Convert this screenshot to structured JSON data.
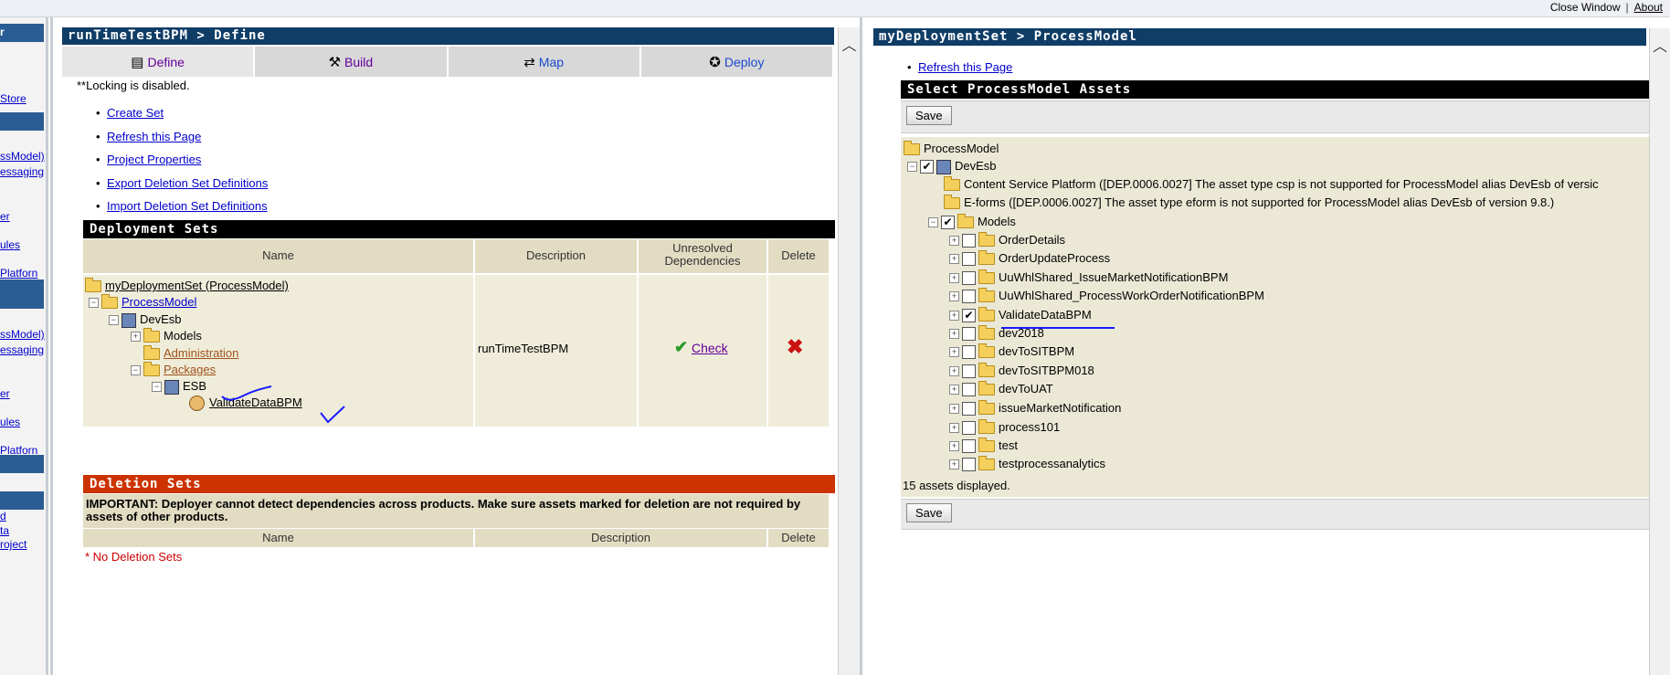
{
  "top_links": {
    "close_window": "Close Window",
    "about": "About"
  },
  "sidebar": {
    "headers": [
      "r"
    ],
    "links": [
      "Store",
      "ssModel)",
      "essaging",
      "er",
      "ules",
      "Platforn",
      "ssModel)",
      "essaging",
      "er",
      "ules",
      "Platforn",
      "d",
      "ta",
      "roject"
    ]
  },
  "left_panel": {
    "title": "runTimeTestBPM > Define",
    "tabs": [
      {
        "label": "Define",
        "icon": "define-icon"
      },
      {
        "label": "Build",
        "icon": "hammer-icon"
      },
      {
        "label": "Map",
        "icon": "map-icon"
      },
      {
        "label": "Deploy",
        "icon": "deploy-icon"
      }
    ],
    "lock_note": "**Locking is disabled.",
    "links": [
      "Create Set",
      "Refresh this Page",
      "Project Properties",
      "Export Deletion Set Definitions",
      "Import Deletion Set Definitions"
    ],
    "deployment_sets": {
      "header": "Deployment Sets",
      "columns": [
        "Name",
        "Description",
        "Unresolved Dependencies",
        "Delete"
      ],
      "tree": {
        "root": "myDeploymentSet (ProcessModel)",
        "process_model": "ProcessModel",
        "server": "DevEsb",
        "models": "Models",
        "administration": "Administration",
        "packages": "Packages",
        "esb": "ESB",
        "package_item": "ValidateDataBPM"
      },
      "description": "runTimeTestBPM",
      "check_label": "Check"
    },
    "deletion_sets": {
      "header": "Deletion Sets",
      "important": "IMPORTANT: Deployer cannot detect dependencies across products. Make sure assets marked for deletion are not required by assets of other products.",
      "columns": [
        "Name",
        "Description",
        "Delete"
      ],
      "empty": "* No Deletion Sets"
    }
  },
  "right_panel": {
    "title": "myDeploymentSet > ProcessModel",
    "refresh_link": "Refresh this Page",
    "section_header": "Select ProcessModel Assets",
    "save_label": "Save",
    "tree": {
      "root": "ProcessModel",
      "server": "DevEsb",
      "csp_note": "Content Service Platform ([DEP.0006.0027] The asset type csp is not supported for ProcessModel alias DevEsb of versic",
      "eform_note": "E-forms ([DEP.0006.0027] The asset type eform is not supported for ProcessModel alias DevEsb of version 9.8.)",
      "models": "Models",
      "items": [
        {
          "label": "OrderDetails",
          "checked": false
        },
        {
          "label": "OrderUpdateProcess",
          "checked": false
        },
        {
          "label": "UuWhlShared_IssueMarketNotificationBPM",
          "checked": false
        },
        {
          "label": "UuWhlShared_ProcessWorkOrderNotificationBPM",
          "checked": false
        },
        {
          "label": "ValidateDataBPM",
          "checked": true
        },
        {
          "label": "dev2018",
          "checked": false
        },
        {
          "label": "devToSITBPM",
          "checked": false
        },
        {
          "label": "devToSITBPM018",
          "checked": false
        },
        {
          "label": "devToUAT",
          "checked": false
        },
        {
          "label": "issueMarketNotification",
          "checked": false
        },
        {
          "label": "process101",
          "checked": false
        },
        {
          "label": "test",
          "checked": false
        },
        {
          "label": "testprocessanalytics",
          "checked": false
        }
      ]
    },
    "assets_count": "15 assets displayed."
  }
}
